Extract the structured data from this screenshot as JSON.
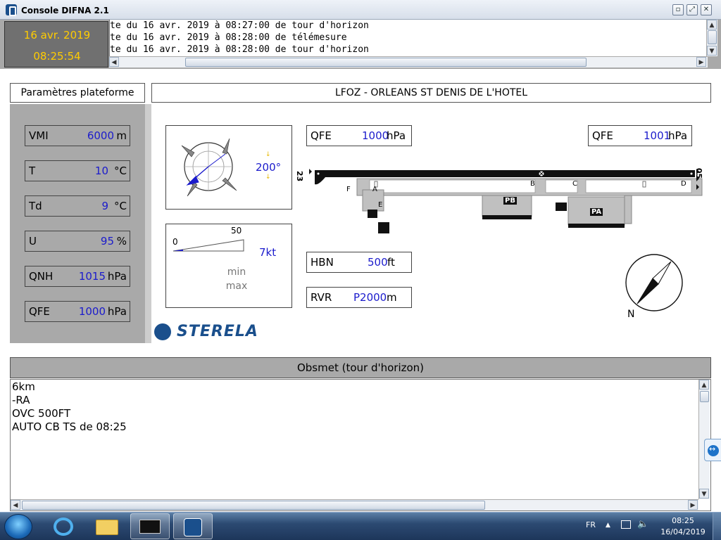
{
  "window": {
    "title": "Console DIFNA 2.1"
  },
  "header": {
    "date": "16 avr. 2019",
    "time": "08:25:54",
    "messages": [
      "te du 16 avr. 2019 à 08:27:00 de tour d'horizon",
      "te du 16 avr. 2019 à 08:28:00 de télémesure",
      "te du 16 avr. 2019 à 08:28:00 de tour d'horizon"
    ]
  },
  "left_panel": {
    "title": "Paramètres plateforme",
    "params": [
      {
        "label": "VMI",
        "value": "6000",
        "unit": "m"
      },
      {
        "label": "T",
        "value": "10",
        "unit": "°C"
      },
      {
        "label": "Td",
        "value": "9",
        "unit": "°C"
      },
      {
        "label": "U",
        "value": "95",
        "unit": "%"
      },
      {
        "label": "QNH",
        "value": "1015",
        "unit": "hPa"
      },
      {
        "label": "QFE",
        "value": "1000",
        "unit": "hPa"
      }
    ]
  },
  "station": {
    "title": "LFOZ - ORLEANS ST DENIS DE L'HOTEL",
    "wind_direction": "200°",
    "wind_scale_min": "0",
    "wind_scale_max": "50",
    "wind_speed": "7kt",
    "wind_speed_fraction": 0.14,
    "wind_min_label": "min",
    "wind_max_label": "max",
    "qfe_left": {
      "label": "QFE",
      "value": "1000",
      "unit": "hPa"
    },
    "qfe_right": {
      "label": "QFE",
      "value": "1001",
      "unit": "hPa"
    },
    "hbn": {
      "label": "HBN",
      "value": "500",
      "unit": "ft"
    },
    "rvr": {
      "label": "RVR",
      "value": "P2000",
      "unit": "m"
    },
    "runway_left": "23",
    "runway_right": "05",
    "taxiway_labels": [
      "A",
      "B",
      "C",
      "D",
      "E",
      "F"
    ],
    "parking_labels": [
      "PB",
      "PA"
    ],
    "north_label": "N",
    "brand": "STERELA"
  },
  "obsmet": {
    "title": "Obsmet (tour d'horizon)",
    "lines": [
      "6km",
      "-RA",
      "OVC 500FT",
      "AUTO CB TS de 08:25"
    ]
  },
  "taskbar": {
    "lang": "FR",
    "time": "08:25",
    "date": "16/04/2019"
  },
  "colors": {
    "value_blue": "#1b1bcc",
    "clock_yellow": "#ffcc00",
    "panel_gray": "#a9a9a9"
  }
}
